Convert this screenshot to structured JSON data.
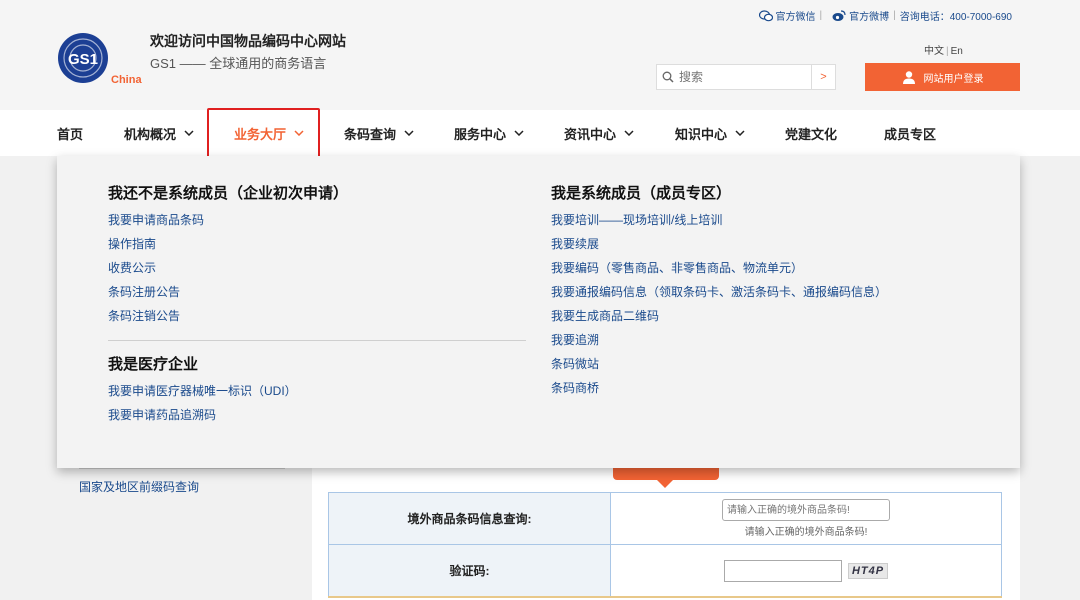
{
  "header": {
    "site_title": "欢迎访问中国物品编码中心网站",
    "slogan": "GS1 —— 全球通用的商务语言",
    "logo_text": "GS1",
    "logo_sub": "China",
    "wechat": "官方微信",
    "weibo": "官方微博",
    "phone": "咨询电话：400-7000-690",
    "lang_zh": "中文",
    "lang_en": "En",
    "search_placeholder": "搜索",
    "search_go": ">",
    "login": "网站用户登录"
  },
  "nav": {
    "items": [
      {
        "label": "首页"
      },
      {
        "label": "机构概况"
      },
      {
        "label": "业务大厅"
      },
      {
        "label": "条码查询"
      },
      {
        "label": "服务中心"
      },
      {
        "label": "资讯中心"
      },
      {
        "label": "知识中心"
      },
      {
        "label": "党建文化"
      },
      {
        "label": "成员专区"
      }
    ]
  },
  "dropdown": {
    "left": {
      "heading1": "我还不是系统成员（企业初次申请）",
      "links1": [
        "我要申请商品条码",
        "操作指南",
        "收费公示",
        "条码注册公告",
        "条码注销公告"
      ],
      "heading2": "我是医疗企业",
      "links2": [
        "我要申请医疗器械唯一标识（UDI）",
        "我要申请药品追溯码"
      ]
    },
    "right": {
      "heading": "我是系统成员（成员专区）",
      "links": [
        "我要培训——现场培训/线上培训",
        "我要续展",
        "我要编码（零售商品、非零售商品、物流单元）",
        "我要通报编码信息（领取条码卡、激活条码卡、通报编码信息）",
        "我要生成商品二维码",
        "我要追溯",
        "条码微站",
        "条码商桥"
      ]
    }
  },
  "sidebar": {
    "link": "国家及地区前缀码查询"
  },
  "query": {
    "row1_label": "境外商品条码信息查询:",
    "row1_placeholder": "请输入正确的境外商品条码!",
    "row1_hint": "请输入正确的境外商品条码!",
    "row2_label": "验证码:",
    "captcha": "HT4P"
  }
}
